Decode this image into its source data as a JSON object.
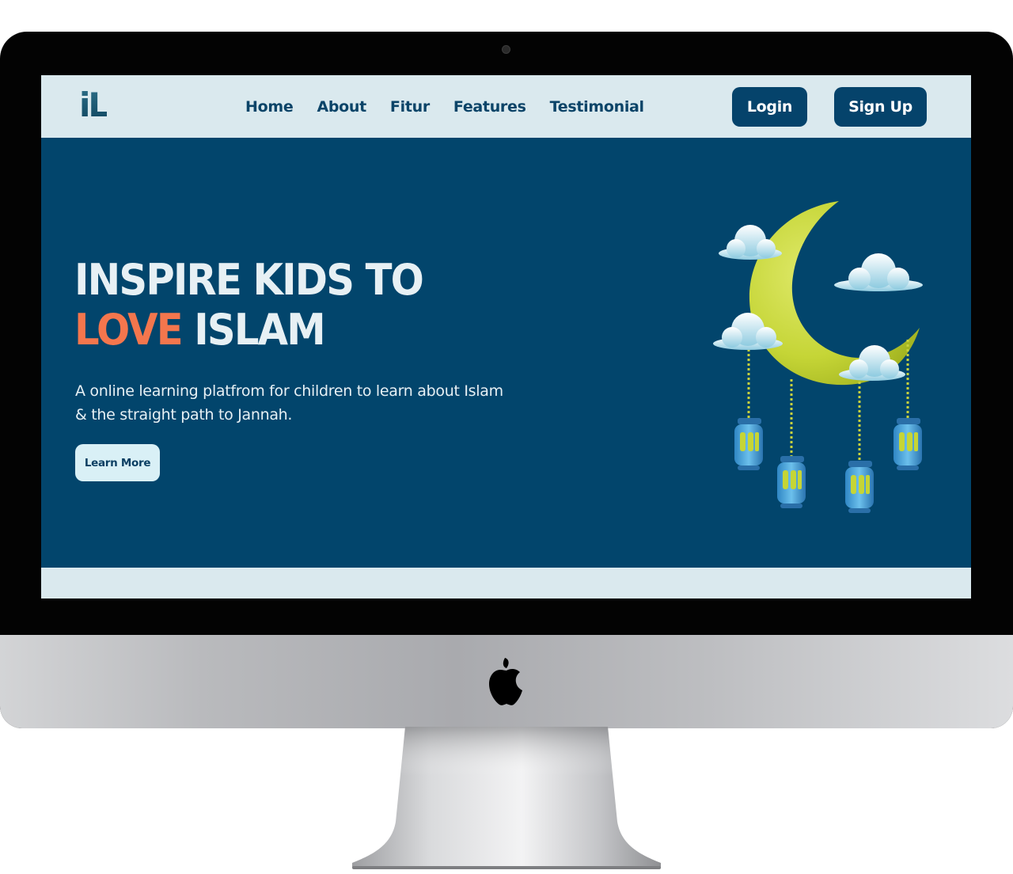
{
  "brand": {
    "logo_text": "iL"
  },
  "nav": {
    "links": [
      "Home",
      "About",
      "Fitur",
      "Features",
      "Testimonial"
    ],
    "login_label": "Login",
    "signup_label": "Sign Up"
  },
  "hero": {
    "headline_line1": "INSPIRE KIDS TO",
    "headline_accent": "LOVE",
    "headline_rest": " ISLAM",
    "subtitle": "A online learning platfrom for children to learn about Islam & the straight path to Jannah.",
    "cta_label": "Learn More"
  },
  "colors": {
    "primary": "#02456c",
    "navbar_bg": "#dae9ee",
    "accent": "#f4764d",
    "text_light": "#e7f0f4",
    "button_light": "#d9f0f6"
  },
  "icons": {
    "brand_logo": "apple-logo-icon",
    "illustration": "crescent-moon-lanterns-illustration"
  }
}
